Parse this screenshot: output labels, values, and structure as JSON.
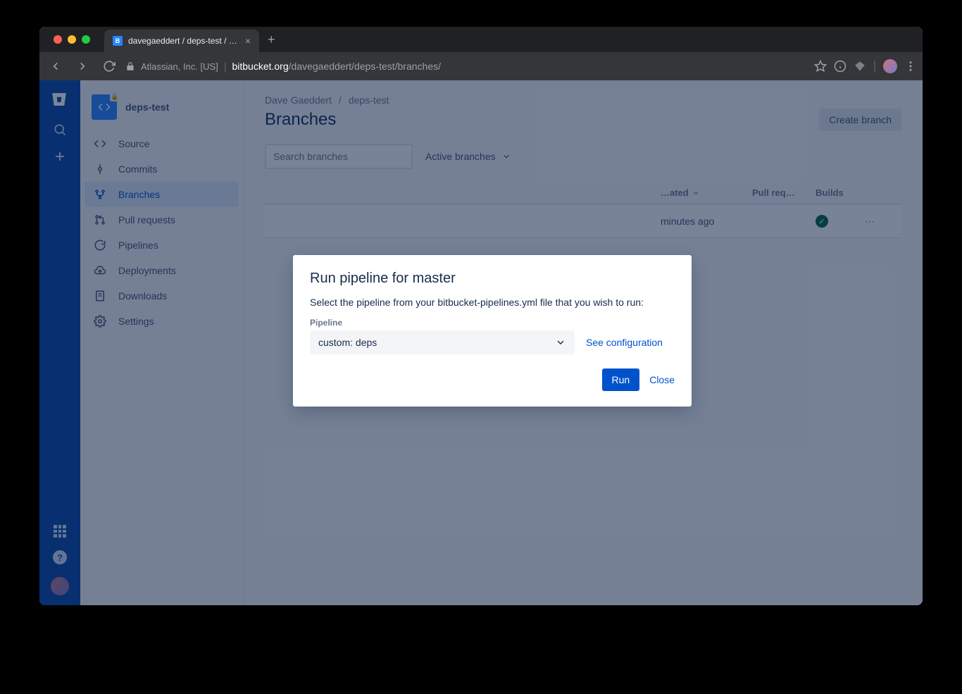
{
  "browser": {
    "tab_title": "davegaeddert / deps-test / Bra…",
    "cert": "Atlassian, Inc. [US]",
    "host": "bitbucket.org",
    "path": "/davegaeddert/deps-test/branches/"
  },
  "project": {
    "name": "deps-test"
  },
  "sidebar": {
    "items": [
      {
        "label": "Source"
      },
      {
        "label": "Commits"
      },
      {
        "label": "Branches"
      },
      {
        "label": "Pull requests"
      },
      {
        "label": "Pipelines"
      },
      {
        "label": "Deployments"
      },
      {
        "label": "Downloads"
      },
      {
        "label": "Settings"
      }
    ]
  },
  "breadcrumb": {
    "owner": "Dave Gaeddert",
    "repo": "deps-test"
  },
  "page": {
    "title": "Branches",
    "create_label": "Create branch",
    "search_placeholder": "Search branches",
    "filter": "Active branches"
  },
  "table": {
    "headers": {
      "updated": "…ated",
      "pr": "Pull req…",
      "builds": "Builds"
    },
    "row": {
      "updated": "minutes ago"
    }
  },
  "modal": {
    "title": "Run pipeline for master",
    "desc": "Select the pipeline from your bitbucket-pipelines.yml file that you wish to run:",
    "field_label": "Pipeline",
    "selected": "custom: deps",
    "see_config": "See configuration",
    "run": "Run",
    "close": "Close"
  }
}
